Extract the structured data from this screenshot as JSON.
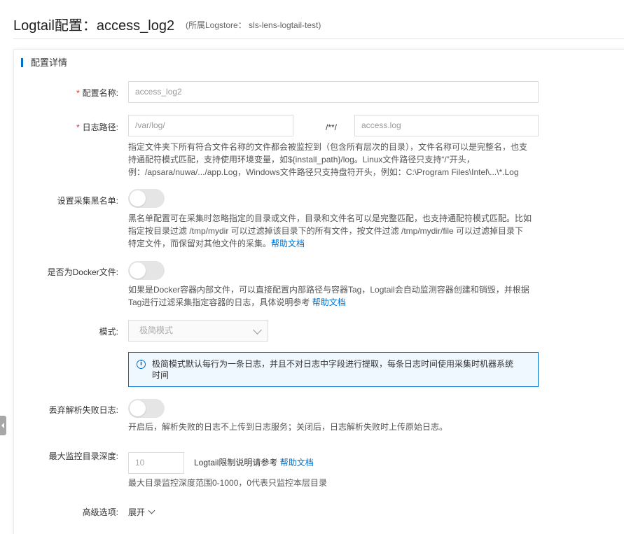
{
  "header": {
    "title": "Logtail配置：access_log2",
    "subtitle": "(所属Logstore： sls-lens-logtail-test)"
  },
  "section": {
    "title": "配置详情"
  },
  "config_name": {
    "label": "配置名称:",
    "required_mark": "*",
    "value": "access_log2"
  },
  "log_path": {
    "label": "日志路径:",
    "required_mark": "*",
    "dir_value": "/var/log/",
    "separator": "/**/",
    "file_value": "access.log",
    "help_lines": [
      "指定文件夹下所有符合文件名称的文件都会被监控到（包含所有层次的目录），文件名称可以是完整名，也支",
      "持通配符模式匹配，支持使用环境变量，如${install_path}/log。Linux文件路径只支持“/”开头，",
      "例：/apsara/nuwa/.../app.Log，Windows文件路径只支持盘符开头，例如：C:\\Program Files\\Intel\\...\\*.Log"
    ]
  },
  "blacklist": {
    "label": "设置采集黑名单:",
    "enabled": false,
    "help_lines": [
      "黑名单配置可在采集时忽略指定的目录或文件，目录和文件名可以是完整匹配，也支持通配符模式匹配。比如",
      "指定按目录过滤 /tmp/mydir 可以过滤掉该目录下的所有文件，按文件过滤 /tmp/mydir/file 可以过滤掉目录下",
      "特定文件，而保留对其他文件的采集。"
    ],
    "help_link": "帮助文档"
  },
  "docker": {
    "label": "是否为Docker文件:",
    "enabled": false,
    "help_lines": [
      "如果是Docker容器内部文件，可以直接配置内部路径与容器Tag，Logtail会自动监测容器创建和销毁，并根据",
      "Tag进行过滤采集指定容器的日志，具体说明参考 "
    ],
    "help_link": "帮助文档"
  },
  "mode": {
    "label": "模式:",
    "selected": "极简模式",
    "info_icon": "info-icon",
    "info_lines": [
      "极简模式默认每行为一条日志，并且不对日志中字段进行提取，每条日志时间使用采集时机器系统",
      "时间"
    ]
  },
  "discard_failed": {
    "label": "丢弃解析失败日志:",
    "enabled": false,
    "help": "开启后，解析失败的日志不上传到日志服务；关闭后，日志解析失败时上传原始日志。"
  },
  "max_depth": {
    "label": "最大监控目录深度:",
    "placeholder": "10",
    "note": "Logtail限制说明请参考 ",
    "note_link": "帮助文档",
    "help": "最大目录监控深度范围0-1000，0代表只监控本层目录"
  },
  "advanced": {
    "label": "高级选项:",
    "toggle_text": "展开"
  },
  "colors": {
    "accent": "#0070cc",
    "required": "#e72b2b",
    "info_bg": "#eff7ff"
  }
}
